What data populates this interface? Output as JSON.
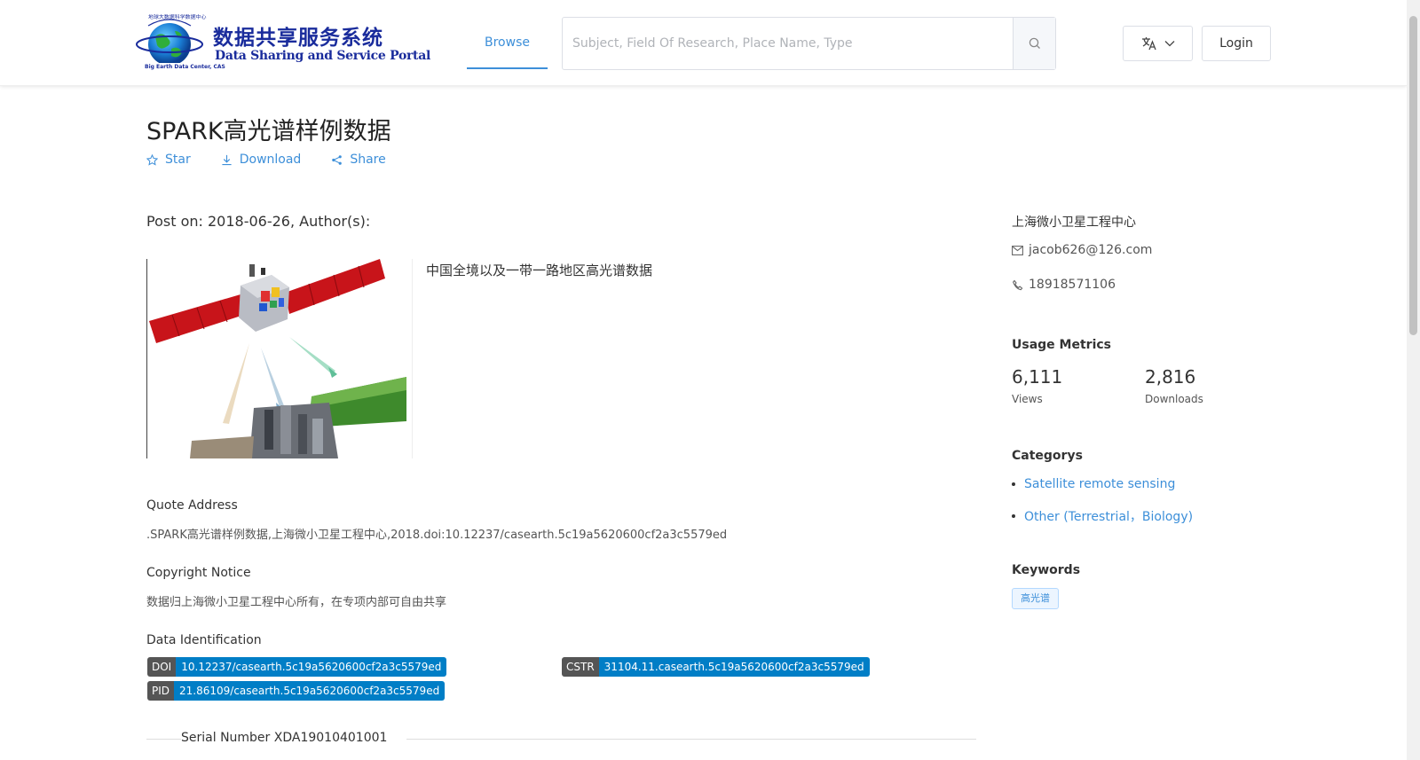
{
  "header": {
    "logo_cn": "数据共享服务系统",
    "logo_en": "Data Sharing and Service Portal",
    "logo_ring_text": "地球大数据科学数据中心",
    "logo_sub_text": "Big Earth Data Center, CAS",
    "nav_browse": "Browse",
    "search_placeholder": "Subject, Field Of Research, Place Name, Type",
    "login": "Login"
  },
  "dataset": {
    "title": "SPARK高光谱样例数据",
    "actions": {
      "star": "Star",
      "download": "Download",
      "share": "Share"
    },
    "post_on": "Post on: 2018-06-26, Author(s):",
    "summary": "中国全境以及一带一路地区高光谱数据",
    "quote_label": "Quote Address",
    "quote_text": ".SPARK高光谱样例数据,上海微小卫星工程中心,2018.doi:10.12237/casearth.5c19a5620600cf2a3c5579ed",
    "copyright_label": "Copyright Notice",
    "copyright_text": "数据归上海微小卫星工程中心所有，在专项内部可自由共享",
    "ident_label": "Data Identification",
    "doi_key": "DOI",
    "doi_value": "10.12237/casearth.5c19a5620600cf2a3c5579ed",
    "cstr_key": "CSTR",
    "cstr_value": "31104.11.casearth.5c19a5620600cf2a3c5579ed",
    "pid_key": "PID",
    "pid_value": "21.86109/casearth.5c19a5620600cf2a3c5579ed",
    "serial": "Serial Number XDA19010401001"
  },
  "sidebar": {
    "org": "上海微小卫星工程中心",
    "email": "jacob626@126.com",
    "phone": "18918571106",
    "metrics_title": "Usage Metrics",
    "views_value": "6,111",
    "views_label": "Views",
    "downloads_value": "2,816",
    "downloads_label": "Downloads",
    "categories_title": "Categorys",
    "categories": [
      "Satellite remote sensing",
      "Other (Terrestrial，Biology)"
    ],
    "keywords_title": "Keywords",
    "keywords": [
      "高光谱"
    ]
  },
  "colors": {
    "accent": "#3d8fd9",
    "tag_key": "#555555",
    "tag_value": "#007ec6",
    "logo": "#1a2c9c"
  }
}
